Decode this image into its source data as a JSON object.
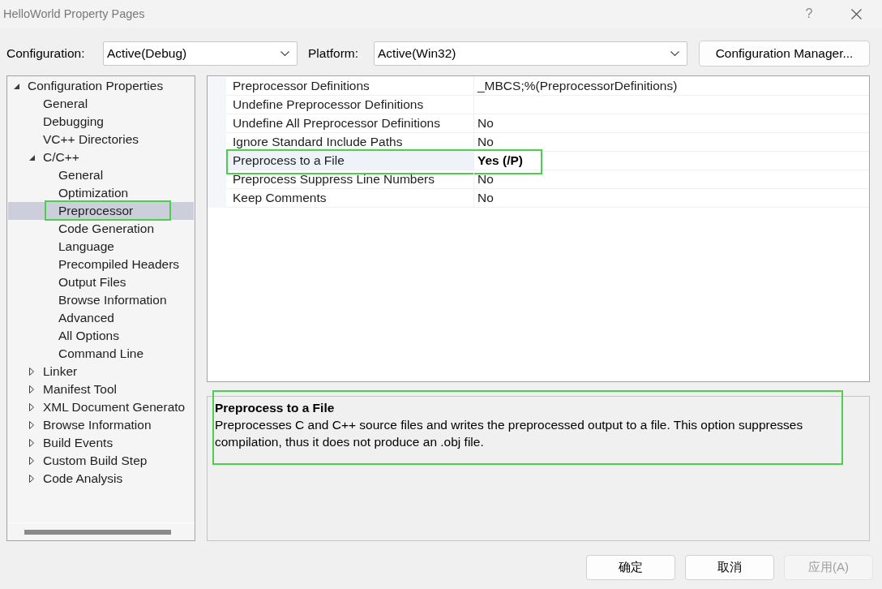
{
  "window": {
    "title": "HelloWorld Property Pages",
    "help": "?"
  },
  "toolbar": {
    "configuration_label": "Configuration:",
    "configuration": "Active(Debug)",
    "platform_label": "Platform:",
    "platform": "Active(Win32)",
    "manager_button": "Configuration Manager..."
  },
  "tree": {
    "items": [
      {
        "label": "Configuration Properties",
        "expanded": true,
        "selected": false,
        "highlighted": false,
        "children": [
          {
            "label": "General",
            "selected": false,
            "highlighted": false
          },
          {
            "label": "Debugging",
            "selected": false,
            "highlighted": false
          },
          {
            "label": "VC++ Directories",
            "selected": false,
            "highlighted": false
          },
          {
            "label": "C/C++",
            "expanded": true,
            "selected": false,
            "highlighted": false,
            "children": [
              {
                "label": "General",
                "selected": false,
                "highlighted": false
              },
              {
                "label": "Optimization",
                "selected": false,
                "highlighted": false
              },
              {
                "label": "Preprocessor",
                "selected": true,
                "highlighted": true
              },
              {
                "label": "Code Generation",
                "selected": false,
                "highlighted": false
              },
              {
                "label": "Language",
                "selected": false,
                "highlighted": false
              },
              {
                "label": "Precompiled Headers",
                "selected": false,
                "highlighted": false
              },
              {
                "label": "Output Files",
                "selected": false,
                "highlighted": false
              },
              {
                "label": "Browse Information",
                "selected": false,
                "highlighted": false
              },
              {
                "label": "Advanced",
                "selected": false,
                "highlighted": false
              },
              {
                "label": "All Options",
                "selected": false,
                "highlighted": false
              },
              {
                "label": "Command Line",
                "selected": false,
                "highlighted": false
              }
            ]
          },
          {
            "label": "Linker",
            "expanded": false,
            "selected": false,
            "highlighted": false
          },
          {
            "label": "Manifest Tool",
            "expanded": false,
            "selected": false,
            "highlighted": false
          },
          {
            "label": "XML Document Generato",
            "expanded": false,
            "selected": false,
            "highlighted": false
          },
          {
            "label": "Browse Information",
            "expanded": false,
            "selected": false,
            "highlighted": false
          },
          {
            "label": "Build Events",
            "expanded": false,
            "selected": false,
            "highlighted": false
          },
          {
            "label": "Custom Build Step",
            "expanded": false,
            "selected": false,
            "highlighted": false
          },
          {
            "label": "Code Analysis",
            "expanded": false,
            "selected": false,
            "highlighted": false
          }
        ]
      }
    ]
  },
  "grid": {
    "rows": [
      {
        "name": "Preprocessor Definitions",
        "value": "_MBCS;%(PreprocessorDefinitions)",
        "selected": false,
        "modified": false,
        "highlighted": false
      },
      {
        "name": "Undefine Preprocessor Definitions",
        "selected": false,
        "highlighted": false
      },
      {
        "name": "Undefine All Preprocessor Definitions",
        "value": "No",
        "selected": false,
        "modified": false,
        "highlighted": false
      },
      {
        "name": "Ignore Standard Include Paths",
        "value": "No",
        "selected": false,
        "modified": false,
        "highlighted": false
      },
      {
        "name": "Preprocess to a File",
        "value": "Yes (/P)",
        "selected": true,
        "modified": true,
        "highlighted": true
      },
      {
        "name": "Preprocess Suppress Line Numbers",
        "value": "No",
        "selected": false,
        "modified": false,
        "highlighted": false
      },
      {
        "name": "Keep Comments",
        "value": "No",
        "selected": false,
        "modified": false,
        "highlighted": false
      }
    ]
  },
  "description": {
    "title": "Preprocess to a File",
    "text": "Preprocesses C and C++ source files and writes the preprocessed output to a file. This option suppresses compilation, thus it does not produce an .obj file.",
    "highlighted": true
  },
  "buttons": [
    {
      "label": "确定",
      "disabled": false
    },
    {
      "label": "取消",
      "disabled": false
    },
    {
      "label": "应用(A)",
      "disabled": true
    }
  ]
}
